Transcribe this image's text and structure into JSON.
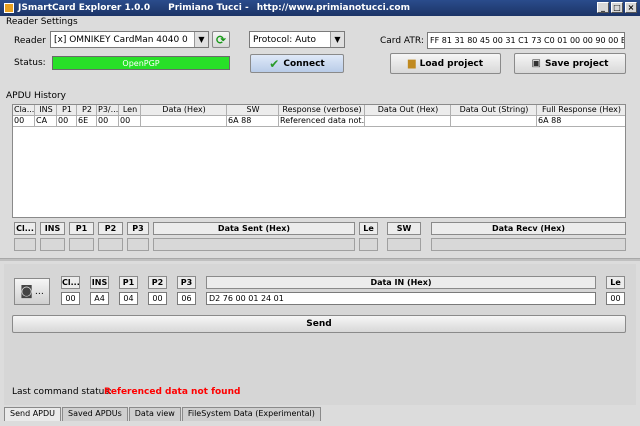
{
  "window": {
    "app_title": "JSmartCard Explorer 1.0.0",
    "author": "Primiano Tucci -",
    "url": "http://www.primianotucci.com",
    "controls": [
      "_",
      "□",
      "×"
    ]
  },
  "reader_settings": {
    "title": "Reader Settings",
    "reader_label": "Reader",
    "reader_value": "[x] OMNIKEY CardMan 4040 0",
    "protocol_value": "Protocol: Auto",
    "card_atr_label": "Card ATR:",
    "card_atr_value": "FF 81 31 80 45 00 31 C1 73 C0 01 00 00 90 00 B1",
    "status_label": "Status:",
    "status_value": "OpenPGP",
    "connect_label": "Connect",
    "load_project_label": "Load project",
    "save_project_label": "Save project"
  },
  "apdu_history": {
    "title": "APDU History",
    "columns": [
      "Cla...",
      "INS",
      "P1",
      "P2",
      "P3/...",
      "Len",
      "Data (Hex)",
      "SW",
      "Response (verbose)",
      "Data Out (Hex)",
      "Data Out (String)",
      "Full Response (Hex)"
    ],
    "rows": [
      [
        "00",
        "CA",
        "00",
        "6E",
        "00",
        "00",
        "",
        "6A 88",
        "Referenced data not...",
        "",
        "",
        "6A 88"
      ]
    ]
  },
  "detail_fields": {
    "cla": "Cl...",
    "ins": "INS",
    "p1": "P1",
    "p2": "P2",
    "p3": "P3",
    "data_sent": "Data Sent (Hex)",
    "le": "Le",
    "sw": "SW",
    "data_recv": "Data Recv (Hex)"
  },
  "send_apdu": {
    "headers": {
      "cla": "Cl...",
      "ins": "INS",
      "p1": "P1",
      "p2": "P2",
      "p3": "P3",
      "data_in": "Data IN (Hex)",
      "le": "Le"
    },
    "values": {
      "cla": "00",
      "ins": "A4",
      "p1": "04",
      "p2": "00",
      "p3": "06",
      "data_in": "D2 76 00 01 24 01",
      "le": "00"
    },
    "send_label": "Send",
    "last_status_label": "Last command status:",
    "last_status_value": "Referenced data not found",
    "status_color": "#ff0000"
  },
  "tabs": [
    "Send APDU",
    "Saved APDUs",
    "Data view",
    "FileSystem Data (Experimental)"
  ]
}
